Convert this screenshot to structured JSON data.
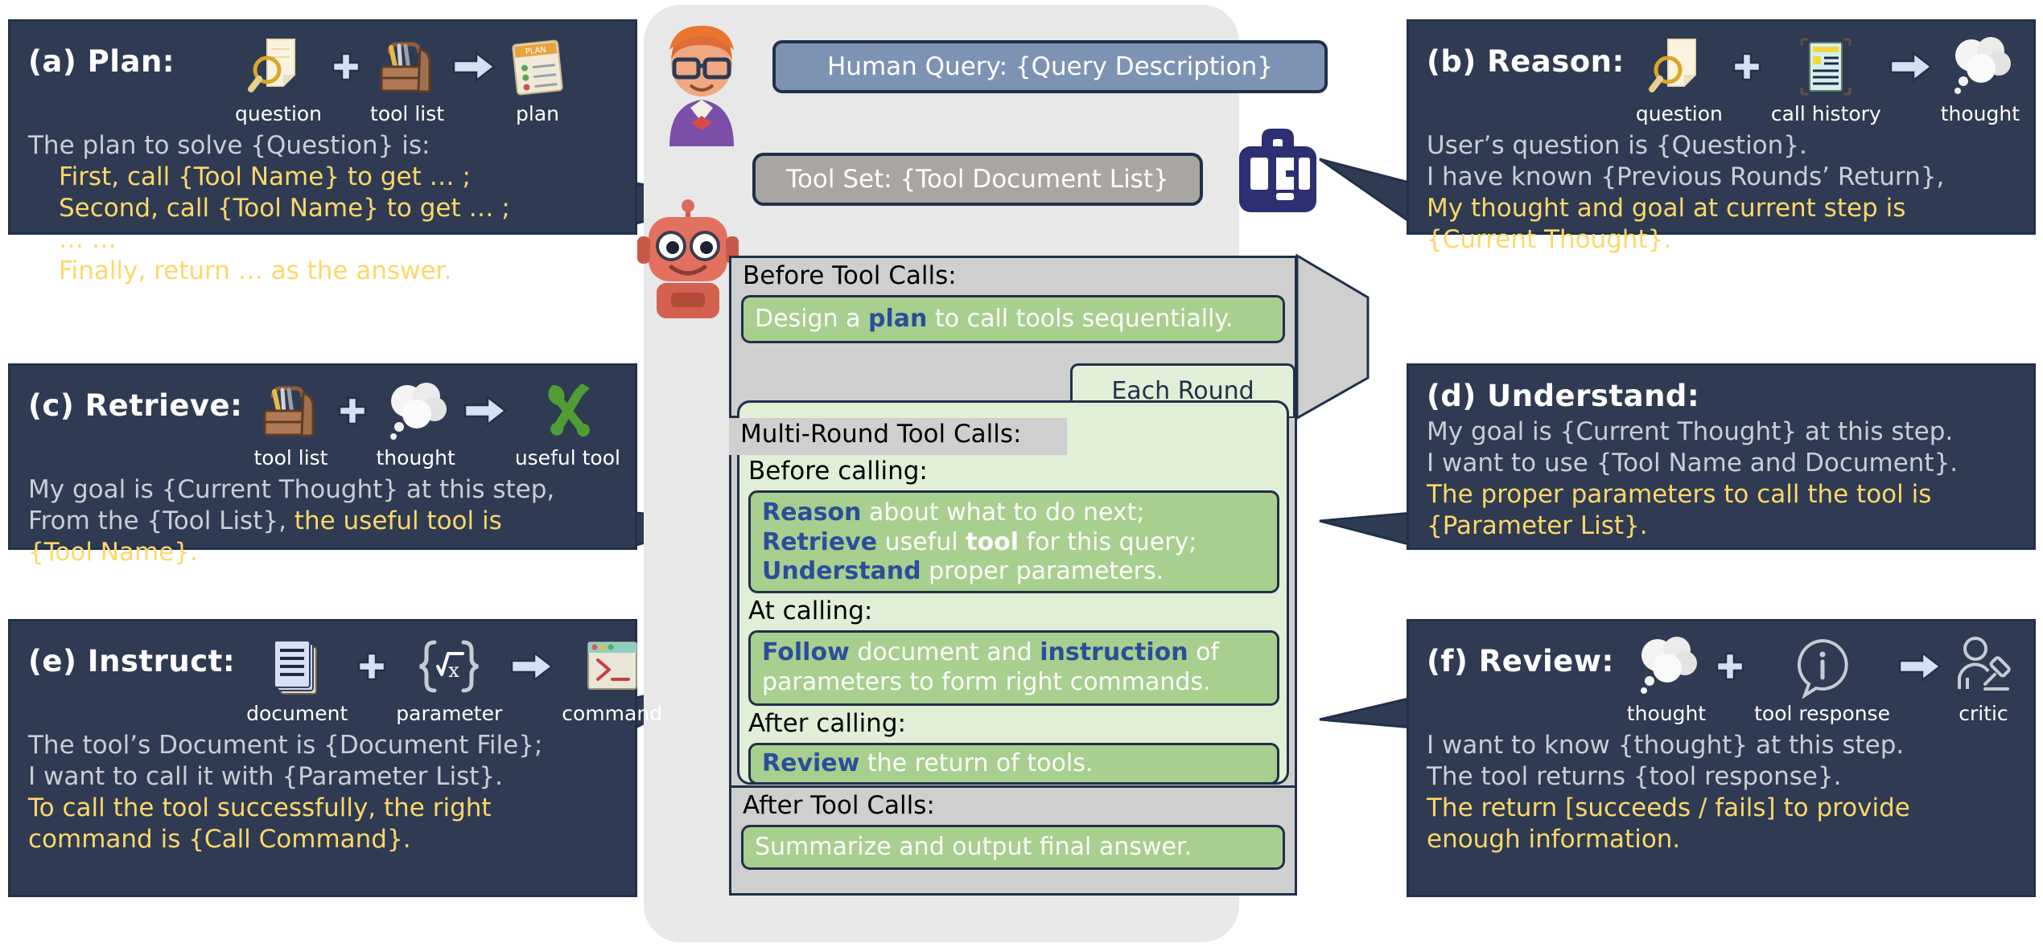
{
  "center": {
    "human_query": "Human Query: {Query Description}",
    "tool_set": "Tool Set: {Tool Document List}",
    "before_tool_calls_label": "Before Tool Calls:",
    "before_tool_calls_box": {
      "pre": "Design a ",
      "kw": "plan",
      "post": " to call tools sequentially."
    },
    "multi_round_label": "Multi-Round Tool Calls:",
    "each_round_tab": "Each Round",
    "before_calling_label": "Before calling:",
    "before_calling_lines": [
      {
        "kw": "Reason",
        "rest": " about what to do next;"
      },
      {
        "kw": "Retrieve",
        "rest": " useful ",
        "kw2": "tool",
        "rest2": " for this query;"
      },
      {
        "kw": "Understand",
        "rest": " proper parameters."
      }
    ],
    "at_calling_label": "At calling:",
    "at_calling_lines": [
      {
        "kw": "Follow",
        "rest": " document and ",
        "kw2": "instruction",
        "rest2": " of"
      },
      {
        "rest": "parameters to form right commands."
      }
    ],
    "after_calling_label": "After calling:",
    "after_calling_lines": [
      {
        "kw": "Review",
        "rest": " the return of tools."
      }
    ],
    "after_tool_calls_label": "After Tool Calls:",
    "after_tool_calls_box": "Summarize and output final answer.",
    "icons": {
      "user": "user-avatar-icon",
      "robot": "robot-avatar-icon",
      "toolbox": "toolbox-wrench-icon"
    }
  },
  "panels": [
    {
      "id": "a",
      "title": "(a) Plan:",
      "icons": [
        {
          "name": "question-magnifier-icon",
          "caption": "question"
        },
        {
          "name": "plus-icon",
          "caption": ""
        },
        {
          "name": "toolbox-icon",
          "caption": "tool list"
        },
        {
          "name": "arrow-right-icon",
          "caption": ""
        },
        {
          "name": "plan-clipboard-icon",
          "caption": "plan"
        }
      ],
      "body": [
        {
          "text": "The plan to solve {Question} is:",
          "style": "gy",
          "indent": false
        },
        {
          "text": "First, call {Tool Name} to get … ;",
          "style": "hl",
          "indent": true
        },
        {
          "text": "Second, call {Tool Name} to get … ;",
          "style": "hl",
          "indent": true
        },
        {
          "text": "… …",
          "style": "hl",
          "indent": true
        },
        {
          "text": "Finally, return … as the answer.",
          "style": "hl",
          "indent": true
        }
      ]
    },
    {
      "id": "c",
      "title": "(c) Retrieve:",
      "icons": [
        {
          "name": "toolbox-icon",
          "caption": "tool list"
        },
        {
          "name": "plus-icon",
          "caption": ""
        },
        {
          "name": "thought-cloud-icon",
          "caption": "thought"
        },
        {
          "name": "arrow-right-icon",
          "caption": ""
        },
        {
          "name": "wrench-screwdriver-icon",
          "caption": "useful tool"
        }
      ],
      "body": [
        {
          "text": "My goal is {Current Thought} at this step,",
          "style": "gy",
          "indent": false
        },
        {
          "text": "From the {Tool List},",
          "style": "gy",
          "indent": false,
          "tail": " the useful tool is",
          "tail_style": "hl"
        },
        {
          "text": "{Tool Name}.",
          "style": "hl",
          "indent": false
        }
      ]
    },
    {
      "id": "e",
      "title": "(e) Instruct:",
      "icons": [
        {
          "name": "documents-stack-icon",
          "caption": "document"
        },
        {
          "name": "plus-icon",
          "caption": ""
        },
        {
          "name": "parameter-braces-icon",
          "caption": "parameter"
        },
        {
          "name": "arrow-right-icon",
          "caption": ""
        },
        {
          "name": "terminal-window-icon",
          "caption": "command"
        }
      ],
      "body": [
        {
          "text": "The tool’s Document is {Document File};",
          "style": "gy",
          "indent": false
        },
        {
          "text": "I want to call it with {Parameter List}.",
          "style": "gy",
          "indent": false
        },
        {
          "text": "To call the tool successfully, the right",
          "style": "hl",
          "indent": false
        },
        {
          "text": "command is {Call Command}.",
          "style": "hl",
          "indent": false
        }
      ]
    },
    {
      "id": "b",
      "title": "(b) Reason:",
      "icons": [
        {
          "name": "question-magnifier-icon",
          "caption": "question"
        },
        {
          "name": "plus-icon",
          "caption": ""
        },
        {
          "name": "call-history-document-icon",
          "caption": "call history"
        },
        {
          "name": "arrow-right-icon",
          "caption": ""
        },
        {
          "name": "thought-cloud-icon",
          "caption": "thought"
        }
      ],
      "body": [
        {
          "text": "User’s question is {Question}.",
          "style": "gy",
          "indent": false
        },
        {
          "text": "I have known {Previous Rounds’ Return},",
          "style": "gy",
          "indent": false
        },
        {
          "text": "My thought and goal at current step is",
          "style": "hl",
          "indent": false
        },
        {
          "text": "{Current Thought}.",
          "style": "hl",
          "indent": false
        }
      ]
    },
    {
      "id": "d",
      "title": "(d) Understand:",
      "icons": [],
      "body": [
        {
          "text": "My goal is {Current Thought} at this step.",
          "style": "gy",
          "indent": false
        },
        {
          "text": "I want to use {Tool Name and Document}.",
          "style": "gy",
          "indent": false
        },
        {
          "text": "The proper parameters to call the tool is",
          "style": "hl",
          "indent": false
        },
        {
          "text": "{Parameter List}.",
          "style": "hl",
          "indent": false
        }
      ]
    },
    {
      "id": "f",
      "title": "(f) Review:",
      "icons": [
        {
          "name": "thought-cloud-icon",
          "caption": "thought"
        },
        {
          "name": "plus-icon",
          "caption": ""
        },
        {
          "name": "info-speech-bubble-icon",
          "caption": "tool response"
        },
        {
          "name": "arrow-right-icon",
          "caption": ""
        },
        {
          "name": "critic-gavel-icon",
          "caption": "critic"
        }
      ],
      "body": [
        {
          "text": "I want to know {thought} at this step.",
          "style": "gy",
          "indent": false
        },
        {
          "text": "The tool returns {tool response}.",
          "style": "gy",
          "indent": false
        },
        {
          "text": "The return [succeeds / fails] to provide",
          "style": "hl",
          "indent": false
        },
        {
          "text": "enough information.",
          "style": "hl",
          "indent": false
        }
      ]
    }
  ],
  "colors": {
    "panel_bg": "#2f3b52",
    "panel_border": "#21304a",
    "highlight": "#ffd76a",
    "body_text": "#c9ced6",
    "green_dark": "#a8cf8e",
    "green_light": "#e0efd6",
    "blue_keyword": "#2b4e9b",
    "query_bubble": "#7e93b4",
    "toolset_bubble": "#a8a5a3"
  }
}
